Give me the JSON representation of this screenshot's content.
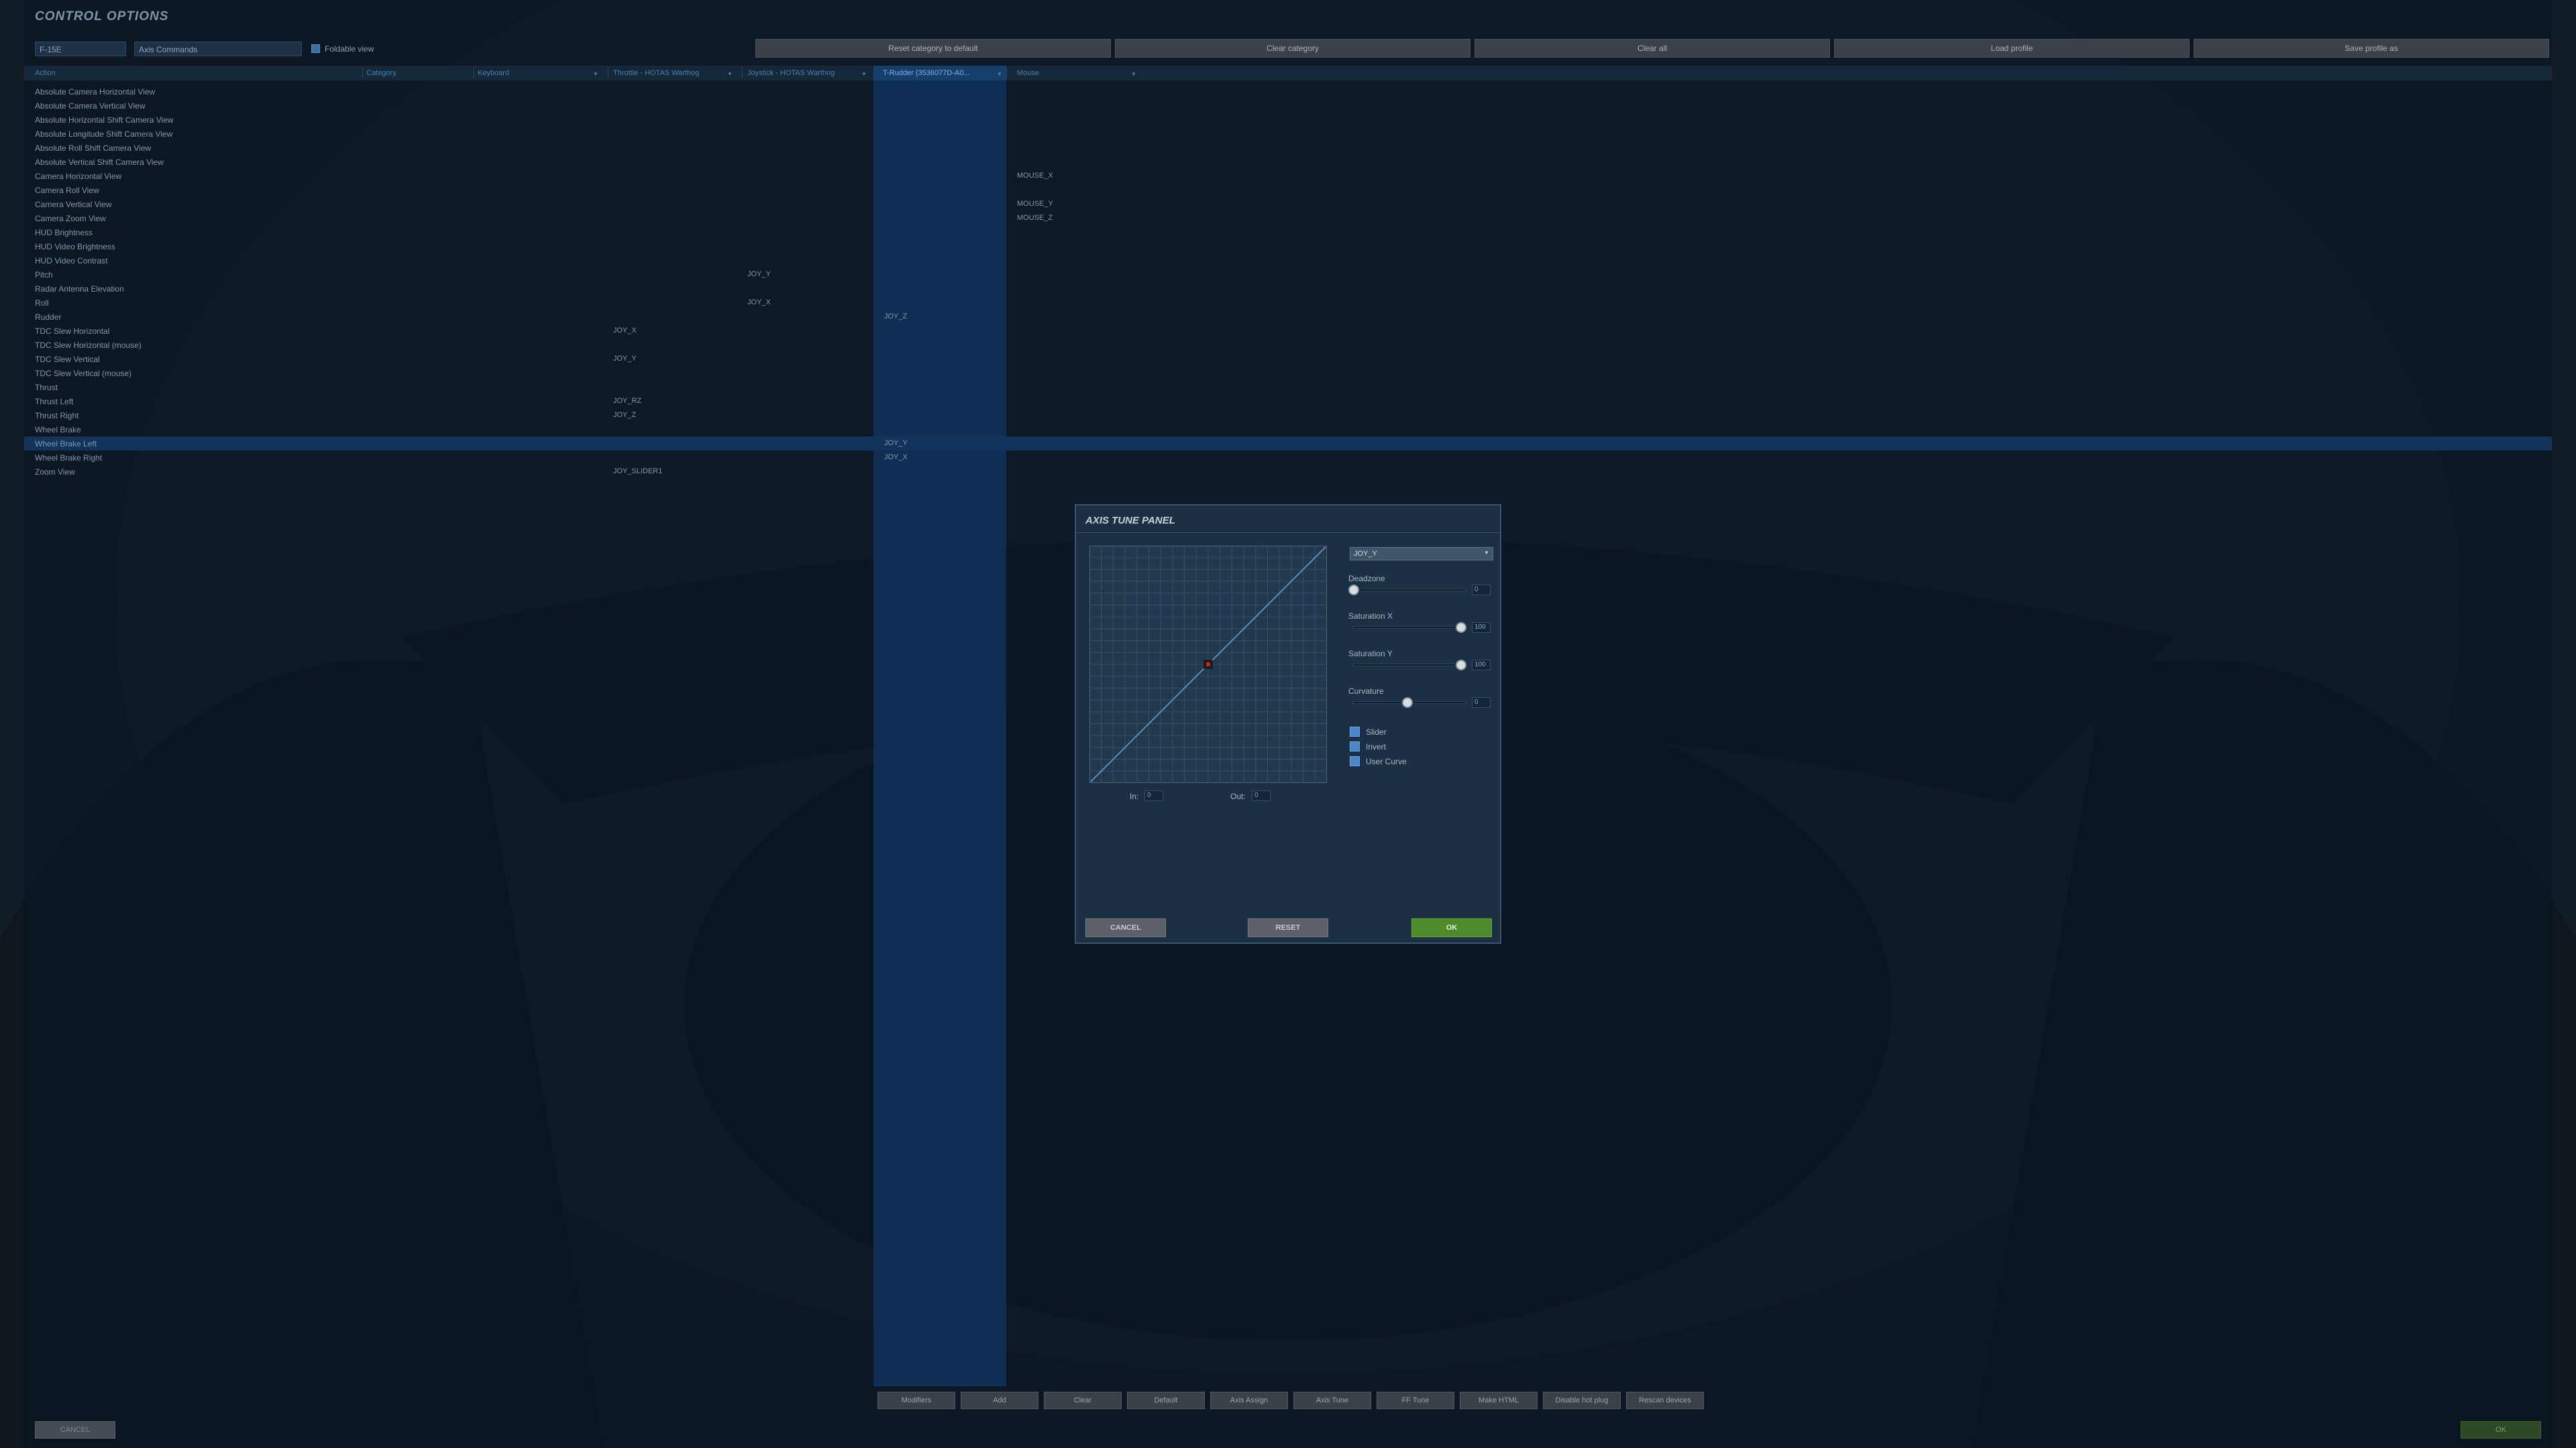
{
  "window": {
    "title": "CONTROL OPTIONS"
  },
  "top_bar": {
    "aircraft_select": "F-15E",
    "category_select": "Axis Commands",
    "foldable_label": "Foldable view",
    "buttons": [
      "Reset category to default",
      "Clear category",
      "Clear all",
      "Load profile",
      "Save profile as"
    ]
  },
  "columns": [
    "Action",
    "Category",
    "Keyboard",
    "Throttle - HOTAS Warthog",
    "Joystick - HOTAS Warthog",
    "T-Rudder {3536077D-A0...",
    "Mouse"
  ],
  "rows": [
    {
      "action": "Absolute Camera Horizontal View",
      "throttle": "",
      "joystick": "",
      "rudder": "",
      "mouse": ""
    },
    {
      "action": "Absolute Camera Vertical View",
      "throttle": "",
      "joystick": "",
      "rudder": "",
      "mouse": ""
    },
    {
      "action": "Absolute Horizontal Shift Camera View",
      "throttle": "",
      "joystick": "",
      "rudder": "",
      "mouse": ""
    },
    {
      "action": "Absolute Longitude Shift Camera View",
      "throttle": "",
      "joystick": "",
      "rudder": "",
      "mouse": ""
    },
    {
      "action": "Absolute Roll Shift Camera View",
      "throttle": "",
      "joystick": "",
      "rudder": "",
      "mouse": ""
    },
    {
      "action": "Absolute Vertical Shift Camera View",
      "throttle": "",
      "joystick": "",
      "rudder": "",
      "mouse": ""
    },
    {
      "action": "Camera Horizontal View",
      "throttle": "",
      "joystick": "",
      "rudder": "",
      "mouse": "MOUSE_X"
    },
    {
      "action": "Camera Roll View",
      "throttle": "",
      "joystick": "",
      "rudder": "",
      "mouse": ""
    },
    {
      "action": "Camera Vertical View",
      "throttle": "",
      "joystick": "",
      "rudder": "",
      "mouse": "MOUSE_Y"
    },
    {
      "action": "Camera Zoom View",
      "throttle": "",
      "joystick": "",
      "rudder": "",
      "mouse": "MOUSE_Z"
    },
    {
      "action": "HUD Brightness",
      "throttle": "",
      "joystick": "",
      "rudder": "",
      "mouse": ""
    },
    {
      "action": "HUD Video Brightness",
      "throttle": "",
      "joystick": "",
      "rudder": "",
      "mouse": ""
    },
    {
      "action": "HUD Video Contrast",
      "throttle": "",
      "joystick": "",
      "rudder": "",
      "mouse": ""
    },
    {
      "action": "Pitch",
      "throttle": "",
      "joystick": "JOY_Y",
      "rudder": "",
      "mouse": ""
    },
    {
      "action": "Radar Antenna Elevation",
      "throttle": "",
      "joystick": "",
      "rudder": "",
      "mouse": ""
    },
    {
      "action": "Roll",
      "throttle": "",
      "joystick": "JOY_X",
      "rudder": "",
      "mouse": ""
    },
    {
      "action": "Rudder",
      "throttle": "",
      "joystick": "",
      "rudder": "JOY_Z",
      "mouse": ""
    },
    {
      "action": "TDC Slew Horizontal",
      "throttle": "JOY_X",
      "joystick": "",
      "rudder": "",
      "mouse": ""
    },
    {
      "action": "TDC Slew Horizontal (mouse)",
      "throttle": "",
      "joystick": "",
      "rudder": "",
      "mouse": ""
    },
    {
      "action": "TDC Slew Vertical",
      "throttle": "JOY_Y",
      "joystick": "",
      "rudder": "",
      "mouse": ""
    },
    {
      "action": "TDC Slew Vertical (mouse)",
      "throttle": "",
      "joystick": "",
      "rudder": "",
      "mouse": ""
    },
    {
      "action": "Thrust",
      "throttle": "",
      "joystick": "",
      "rudder": "",
      "mouse": ""
    },
    {
      "action": "Thrust Left",
      "throttle": "JOY_RZ",
      "joystick": "",
      "rudder": "",
      "mouse": ""
    },
    {
      "action": "Thrust Right",
      "throttle": "JOY_Z",
      "joystick": "",
      "rudder": "",
      "mouse": ""
    },
    {
      "action": "Wheel Brake",
      "throttle": "",
      "joystick": "",
      "rudder": "",
      "mouse": ""
    },
    {
      "action": "Wheel Brake Left",
      "throttle": "",
      "joystick": "",
      "rudder": "JOY_Y",
      "mouse": ""
    },
    {
      "action": "Wheel Brake Right",
      "throttle": "",
      "joystick": "",
      "rudder": "JOY_X",
      "mouse": ""
    },
    {
      "action": "Zoom View",
      "throttle": "JOY_SLIDER1",
      "joystick": "",
      "rudder": "",
      "mouse": ""
    }
  ],
  "selected_row": 25,
  "bottom_bar": {
    "buttons": [
      "Modifiers",
      "Add",
      "Clear",
      "Default",
      "Axis Assign",
      "Axis Tune",
      "FF Tune",
      "Make HTML",
      "Disable hot plug",
      "Rescan devices"
    ],
    "cancel": "CANCEL",
    "ok": "OK"
  },
  "axis_tune": {
    "title": "AXIS TUNE PANEL",
    "axis_select": "JOY_Y",
    "deadzone": {
      "label": "Deadzone",
      "value": "0"
    },
    "saturation_x": {
      "label": "Saturation X",
      "value": "100"
    },
    "saturation_y": {
      "label": "Saturation Y",
      "value": "100"
    },
    "curvature": {
      "label": "Curvature",
      "value": "0"
    },
    "checkboxes": {
      "slider": "Slider",
      "invert": "Invert",
      "user_curve": "User Curve"
    },
    "in_label": "In:",
    "in_value": "0",
    "out_label": "Out:",
    "out_value": "0",
    "buttons": {
      "cancel": "CANCEL",
      "reset": "RESET",
      "ok": "OK"
    }
  }
}
